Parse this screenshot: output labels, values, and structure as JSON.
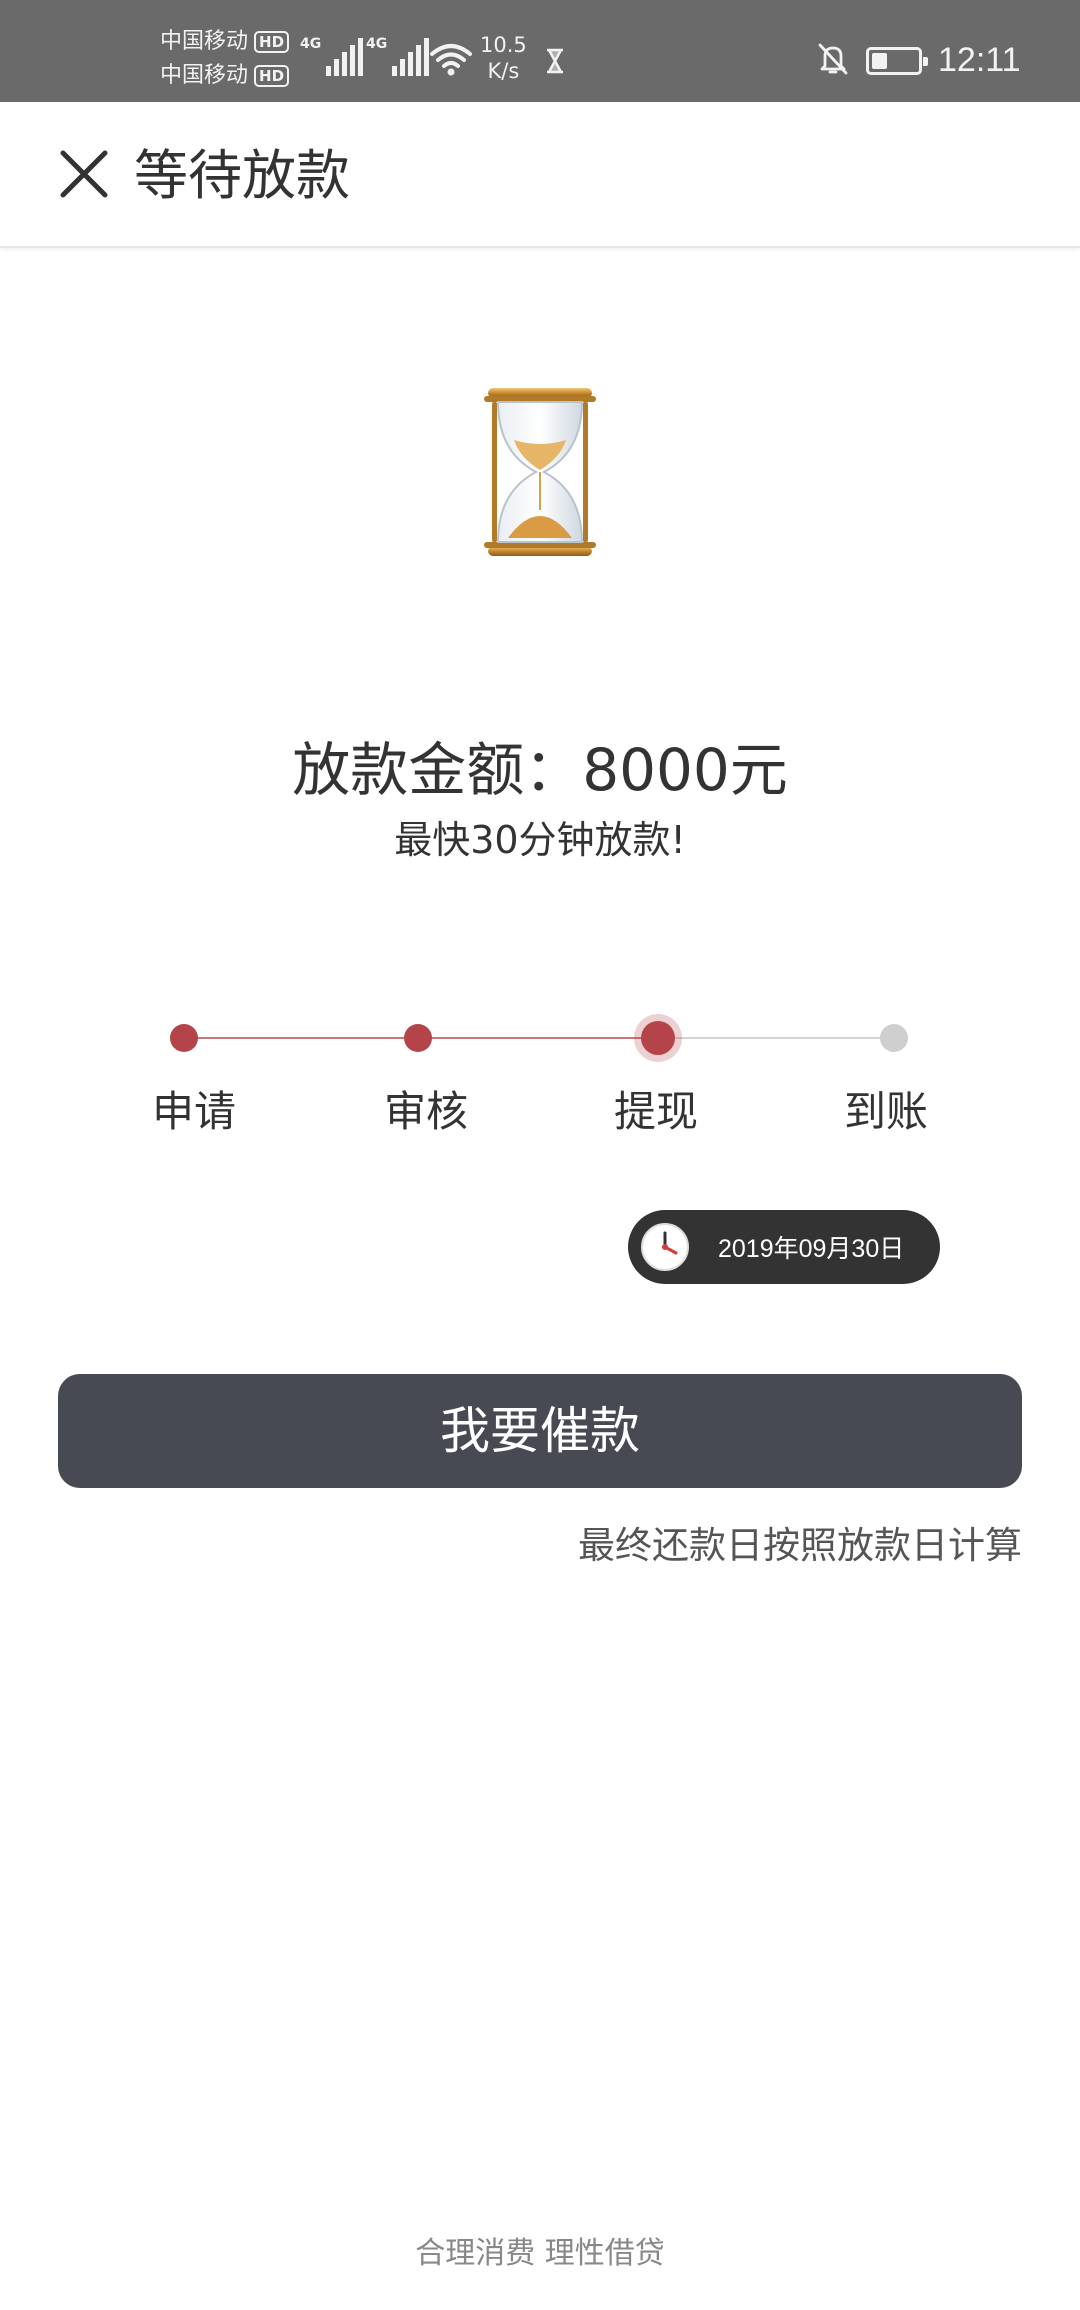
{
  "status_bar": {
    "carrier1": "中国移动",
    "carrier2": "中国移动",
    "hd": "HD",
    "network_tag": "4G",
    "speed_value": "10.5",
    "speed_unit": "K/s",
    "time": "12:11",
    "battery_level": 0.35,
    "icons": [
      "signal-icon",
      "wifi-icon",
      "hourglass-icon",
      "bell-off-icon",
      "battery-icon"
    ]
  },
  "header": {
    "title": "等待放款",
    "close_icon": "close-icon"
  },
  "hero": {
    "icon": "hourglass-icon"
  },
  "loan": {
    "amount_text": "放款金额：8000元",
    "subtitle": "最快30分钟放款!"
  },
  "progress": {
    "steps": [
      {
        "label": "申请",
        "state": "done"
      },
      {
        "label": "审核",
        "state": "done"
      },
      {
        "label": "提现",
        "state": "current"
      },
      {
        "label": "到账",
        "state": "todo"
      }
    ],
    "colors": {
      "done": "#b5434a",
      "todo": "#cfcfcf"
    }
  },
  "date_pill": {
    "icon": "clock-icon",
    "date": "2019年09月30日"
  },
  "actions": {
    "urge_label": "我要催款"
  },
  "note": "最终还款日按照放款日计算",
  "footer": {
    "slogan": "合理消费 理性借贷"
  },
  "theme": {
    "button_bg": "#474a53",
    "status_bg": "#6a6a6a",
    "accent": "#b5434a"
  }
}
